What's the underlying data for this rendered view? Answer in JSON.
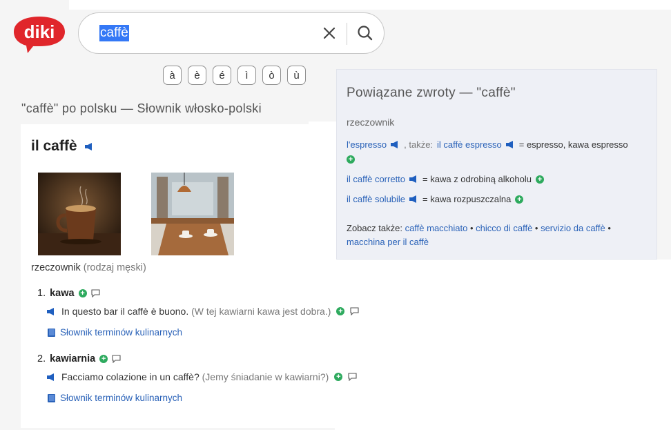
{
  "search": {
    "query": "caffè",
    "clear_icon": "close-icon",
    "search_icon": "search-icon"
  },
  "logo": {
    "text": "diki",
    "color": "#e0262b"
  },
  "special_chars": [
    "à",
    "è",
    "é",
    "ì",
    "ò",
    "ù"
  ],
  "page_title": "\"caffè\" po polsku — Słownik włosko-polski",
  "entry": {
    "headword": "il caffè",
    "part_of_speech": "rzeczownik",
    "gender": "(rodzaj męski)",
    "meanings": [
      {
        "number": "1.",
        "translation": "kawa",
        "example": "In questo bar il caffè è buono.",
        "example_translation": "(W tej kawiarni kawa jest dobra.)",
        "dictionary_link": "Słownik terminów kulinarnych"
      },
      {
        "number": "2.",
        "translation": "kawiarnia",
        "example": "Facciamo colazione in un caffè?",
        "example_translation": "(Jemy śniadanie w kawiarni?)",
        "dictionary_link": "Słownik terminów kulinarnych"
      }
    ]
  },
  "related": {
    "title": "Powiązane zwroty — \"caffè\"",
    "part_of_speech": "rzeczownik",
    "rows": [
      {
        "term": "l'espresso",
        "also_label": ", także:",
        "also_term": "il caffè espresso",
        "translation": "= espresso, kawa espresso"
      },
      {
        "term": "il caffè corretto",
        "translation": "= kawa z odrobiną alkoholu"
      },
      {
        "term": "il caffè solubile",
        "translation": "= kawa rozpuszczalna"
      }
    ],
    "see_also_label": "Zobacz także:",
    "see_also": [
      "caffè macchiato",
      "chicco di caffè",
      "servizio da caffè",
      "macchina per il caffè"
    ]
  },
  "colors": {
    "link": "#2a62b8",
    "plus": "#2eaa5e",
    "speaker": "#1f5fbf",
    "selection": "#3478f6"
  }
}
